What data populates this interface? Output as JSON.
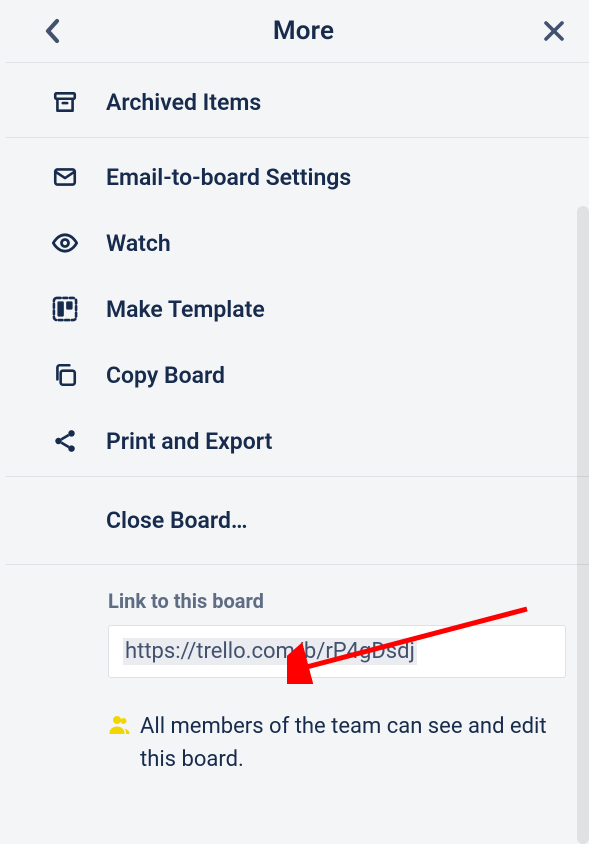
{
  "header": {
    "title": "More"
  },
  "group1": {
    "archived": "Archived Items"
  },
  "group2": {
    "email": "Email-to-board Settings",
    "watch": "Watch",
    "template": "Make Template",
    "copy": "Copy Board",
    "print": "Print and Export"
  },
  "close": {
    "label": "Close Board…"
  },
  "link": {
    "label": "Link to this board",
    "url": "https://trello.com/b/rP4gDsdj"
  },
  "permission": {
    "text": "All members of the team can see and edit this board."
  }
}
